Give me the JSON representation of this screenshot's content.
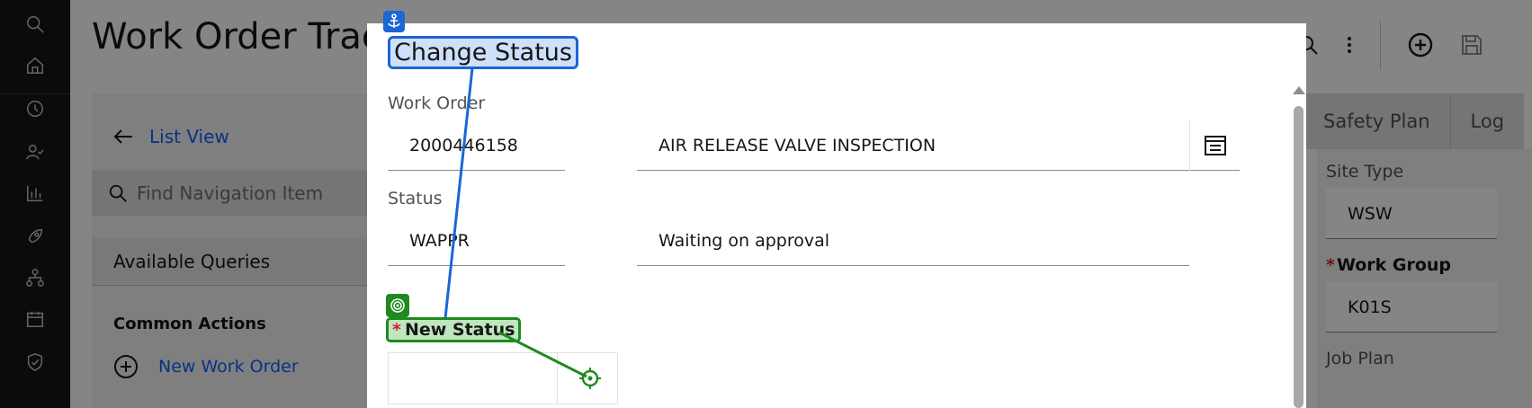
{
  "rail": {
    "icons": [
      "search-icon",
      "home-icon",
      "history-icon",
      "user-check-icon",
      "chart-bar-icon",
      "rocket-icon",
      "hierarchy-icon",
      "calendar-icon",
      "shield-check-icon"
    ]
  },
  "app": {
    "title": "Work Order Trac",
    "nav": {
      "list_view": "List View",
      "find_placeholder": "Find Navigation Item",
      "available_queries": "Available Queries",
      "common_actions": "Common Actions",
      "new_work_order": "New Work Order"
    },
    "tabs": [
      "Safety Plan",
      "Log"
    ],
    "fields": {
      "site_type_label": "Site Type",
      "site_type_value": "WSW",
      "work_group_label": "Work Group",
      "work_group_value": "K01S",
      "job_plan_label": "Job Plan"
    }
  },
  "modal": {
    "title": "Change Status",
    "work_order_label": "Work Order",
    "work_order_number": "2000446158",
    "work_order_description": "AIR RELEASE VALVE INSPECTION",
    "status_label": "Status",
    "status_code": "WAPPR",
    "status_description": "Waiting on approval",
    "new_status_label": "New Status",
    "new_status_value": "",
    "required_marker": "*"
  },
  "colors": {
    "anchor_annotation": "#1a66d6",
    "target_annotation": "#1f8a1f",
    "link": "#0f62fe",
    "required": "#da1e28"
  }
}
